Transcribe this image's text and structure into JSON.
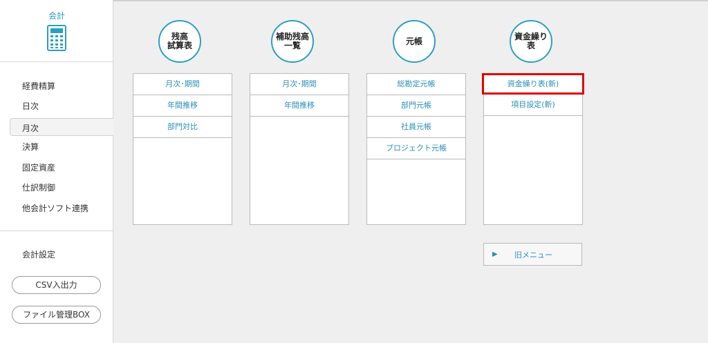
{
  "sidebar": {
    "brand_label": "会計",
    "brand_icon": "calculator-icon",
    "nav": [
      "経費精算",
      "日次",
      "月次",
      "決算",
      "固定資産",
      "仕訳制御",
      "他会計ソフト連携"
    ],
    "active": "月次",
    "settings_label": "会計設定",
    "csv_button": "CSV入出力",
    "file_button": "ファイル管理BOX"
  },
  "columns": [
    {
      "title_lines": [
        "残高",
        "試算表"
      ],
      "items": [
        "月次･期間",
        "年間推移",
        "部門対比"
      ]
    },
    {
      "title_lines": [
        "補助残高",
        "一覧"
      ],
      "items": [
        "月次･期間",
        "年間推移"
      ]
    },
    {
      "title_lines": [
        "元帳"
      ],
      "items": [
        "総勘定元帳",
        "部門元帳",
        "社員元帳",
        "プロジェクト元帳"
      ]
    },
    {
      "title_lines": [
        "資金繰り",
        "表"
      ],
      "items": [
        "資金繰り表(新)",
        "項目設定(新)"
      ],
      "highlighted_index": 0
    }
  ],
  "old_menu": {
    "icon": "play-triangle-icon",
    "label": "旧メニュー"
  },
  "colors": {
    "accent": "#2a9fc0",
    "highlight": "#e00000"
  }
}
